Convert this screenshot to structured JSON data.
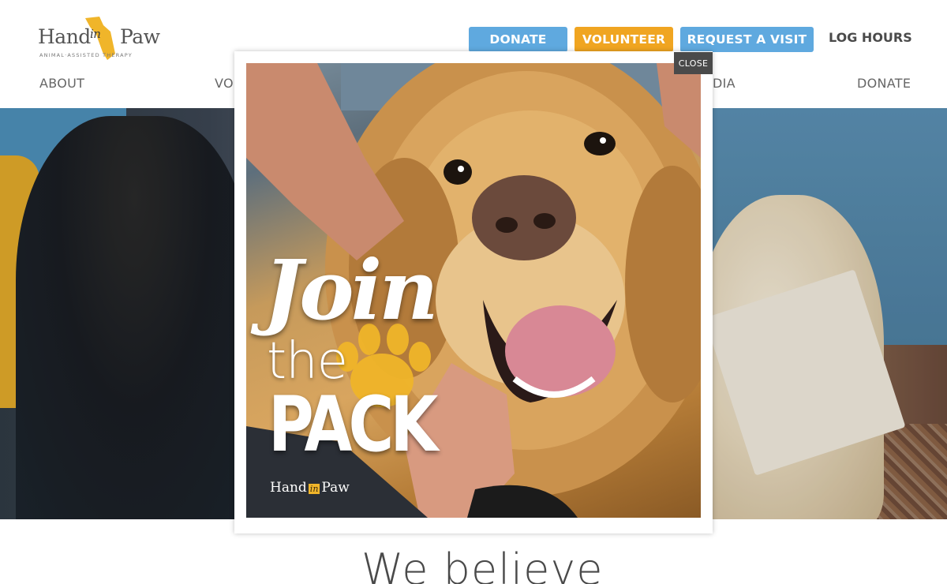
{
  "header": {
    "logo": {
      "word_hand": "Hand",
      "word_in": "in",
      "word_paw": "Paw",
      "tagline": "ANIMAL·ASSISTED     THERAPY"
    },
    "cta": {
      "donate": "DONATE",
      "volunteer": "VOLUNTEER",
      "request_visit": "REQUEST A VISIT"
    },
    "log_hours": "LOG HOURS",
    "nav": {
      "about": "ABOUT",
      "volunteer_partial": "VO",
      "media_partial": "DIA",
      "donate": "DONATE"
    }
  },
  "main": {
    "heading": "We believe"
  },
  "modal": {
    "close_label": "CLOSE",
    "promo": {
      "join": "Join",
      "the": "the",
      "pack": "PACK",
      "logo_hand": "Hand",
      "logo_in": "in",
      "logo_paw": "Paw"
    }
  },
  "colors": {
    "blue_button": "#5fa9df",
    "orange_button": "#f0a521",
    "brand_yellow": "#f0b52a",
    "close_bg": "#4a4a4a"
  }
}
